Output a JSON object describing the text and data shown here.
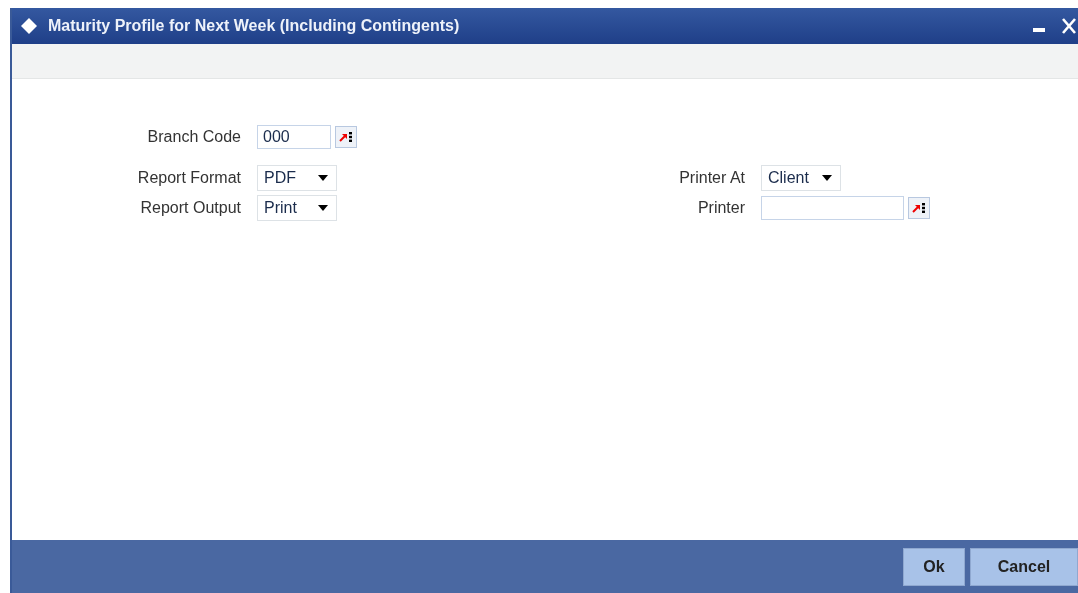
{
  "window": {
    "title": "Maturity Profile for Next Week (Including Contingents)"
  },
  "left_fields": [
    {
      "label": "Branch Code",
      "kind": "lookup",
      "value": "000"
    },
    {
      "label": "Report Format",
      "kind": "select",
      "value": "PDF"
    },
    {
      "label": "Report Output",
      "kind": "select",
      "value": "Print"
    }
  ],
  "right_fields": [
    {
      "label": "Printer At",
      "kind": "select",
      "value": "Client"
    },
    {
      "label": "Printer",
      "kind": "lookup"
    }
  ],
  "buttons": [
    "Ok",
    "Cancel"
  ]
}
